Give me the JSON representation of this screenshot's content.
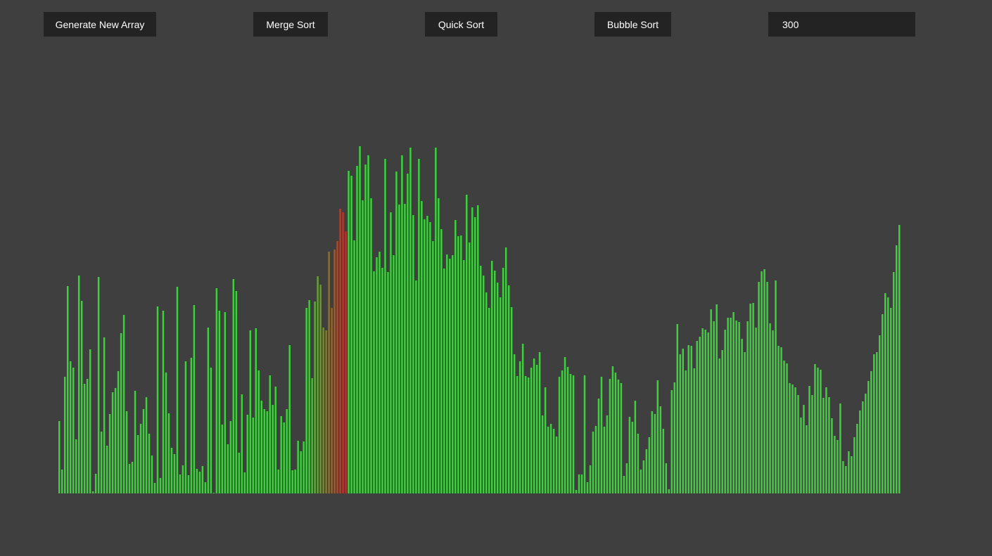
{
  "toolbar": {
    "generate_label": "Generate New Array",
    "merge_label": "Merge Sort",
    "quick_label": "Quick Sort",
    "bubble_label": "Bubble Sort",
    "size_value": "300"
  },
  "colors": {
    "background": "#3f3f3f",
    "button_bg": "#232323",
    "button_text": "#ffffff",
    "bar_default": "#3cd23c",
    "bar_active": "#c82828"
  },
  "chart_data": {
    "type": "bar",
    "bar_count": 300,
    "ylim": [
      0,
      500
    ],
    "active_range": [
      102,
      102
    ],
    "gradient_range": [
      88,
      102
    ],
    "values": [
      103,
      34,
      166,
      295,
      188,
      179,
      77,
      310,
      274,
      156,
      163,
      205,
      3,
      28,
      308,
      88,
      222,
      68,
      113,
      144,
      150,
      174,
      228,
      254,
      117,
      42,
      45,
      146,
      83,
      99,
      120,
      137,
      85,
      54,
      15,
      266,
      22,
      260,
      172,
      114,
      65,
      56,
      294,
      27,
      40,
      188,
      26,
      193,
      268,
      35,
      31,
      39,
      16,
      236,
      179,
      1,
      292,
      260,
      98,
      258,
      70,
      103,
      305,
      288,
      58,
      141,
      30,
      112,
      232,
      108,
      235,
      175,
      132,
      120,
      117,
      168,
      126,
      152,
      34,
      110,
      101,
      120,
      211,
      33,
      34,
      75,
      60,
      74,
      264,
      275,
      164,
      273,
      309,
      297,
      236,
      232,
      344,
      264,
      347,
      359,
      405,
      400,
      373,
      459,
      452,
      360,
      466,
      494,
      417,
      468,
      481,
      420,
      316,
      336,
      344,
      321,
      476,
      315,
      400,
      339,
      458,
      411,
      481,
      412,
      455,
      492,
      396,
      303,
      476,
      416,
      390,
      395,
      386,
      359,
      492,
      420,
      376,
      320,
      340,
      334,
      339,
      389,
      366,
      367,
      332,
      425,
      357,
      407,
      393,
      410,
      324,
      310,
      286,
      264,
      331,
      317,
      300,
      279,
      321,
      350,
      296,
      265,
      198,
      167,
      188,
      213,
      167,
      165,
      179,
      192,
      183,
      201,
      111,
      151,
      95,
      99,
      92,
      81,
      166,
      175,
      194,
      180,
      170,
      168,
      5,
      27,
      27,
      168,
      16,
      40,
      88,
      96,
      135,
      166,
      95,
      111,
      163,
      181,
      172,
      162,
      157,
      25,
      43,
      109,
      102,
      132,
      85,
      34,
      47,
      63,
      80,
      117,
      113,
      161,
      124,
      92,
      43,
      6,
      147,
      158,
      241,
      198,
      206,
      175,
      211,
      210,
      178,
      217,
      223,
      235,
      233,
      229,
      262,
      245,
      269,
      192,
      204,
      233,
      250,
      250,
      258,
      246,
      244,
      220,
      201,
      245,
      270,
      271,
      236,
      301,
      316,
      319,
      301,
      242,
      232,
      303,
      210,
      208,
      189,
      185,
      157,
      155,
      151,
      140,
      108,
      126,
      97,
      153,
      140,
      184,
      179,
      176,
      136,
      151,
      137,
      107,
      82,
      76,
      128,
      46,
      39,
      60,
      53,
      80,
      99,
      118,
      131,
      142,
      160,
      174,
      198,
      201,
      225,
      255,
      285,
      279,
      264,
      315,
      353,
      382
    ]
  }
}
